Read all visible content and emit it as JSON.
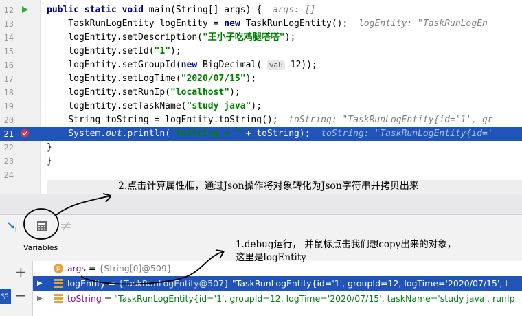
{
  "editor": {
    "lines": [
      {
        "num": "12",
        "segments": [
          [
            "kw",
            "public "
          ],
          [
            "kw",
            "static "
          ],
          [
            "kw",
            "void "
          ],
          [
            "",
            "main(String[] args) {  "
          ],
          [
            "hint",
            "args: []"
          ]
        ]
      },
      {
        "num": "13",
        "segments": [
          [
            "",
            "    TaskRunLogEntity logEntity = "
          ],
          [
            "kw",
            "new "
          ],
          [
            "",
            "TaskRunLogEntity();  "
          ],
          [
            "hint",
            "logEntity: \"TaskRunLogEn"
          ]
        ]
      },
      {
        "num": "14",
        "segments": [
          [
            "",
            "    logEntity.setDescription("
          ],
          [
            "str",
            "\"王小子吃鸡腿嗒嗒\""
          ],
          [
            "",
            ");"
          ]
        ]
      },
      {
        "num": "15",
        "segments": [
          [
            "",
            "    logEntity.setId("
          ],
          [
            "str",
            "\"1\""
          ],
          [
            "",
            ");"
          ]
        ]
      },
      {
        "num": "16",
        "segments": [
          [
            "",
            "    logEntity.setGroupId("
          ],
          [
            "kw",
            "new "
          ],
          [
            "",
            "BigDecimal( "
          ],
          [
            "tag",
            "val:"
          ],
          [
            "",
            " 12));"
          ]
        ]
      },
      {
        "num": "17",
        "segments": [
          [
            "",
            "    logEntity.setLogTime("
          ],
          [
            "str",
            "\"2020/07/15\""
          ],
          [
            "",
            ");"
          ]
        ]
      },
      {
        "num": "18",
        "segments": [
          [
            "",
            "    logEntity.setRunIp("
          ],
          [
            "str",
            "\"localhost\""
          ],
          [
            "",
            ");"
          ]
        ]
      },
      {
        "num": "19",
        "segments": [
          [
            "",
            "    logEntity.setTaskName("
          ],
          [
            "str",
            "\"study java\""
          ],
          [
            "",
            ");"
          ]
        ]
      },
      {
        "num": "20",
        "segments": [
          [
            "",
            "    String toString = logEntity.toString();  "
          ],
          [
            "hint",
            "toString: \"TaskRunLogEntity{id='1', gr"
          ]
        ]
      },
      {
        "num": "21",
        "segments": [
          [
            "",
            "    System."
          ],
          [
            "it",
            "out"
          ],
          [
            "",
            ".println("
          ],
          [
            "str",
            "\"toString = \""
          ],
          [
            "",
            " + toString);  "
          ],
          [
            "hint",
            "toString: \"TaskRunLogEntity{id='"
          ]
        ]
      },
      {
        "num": "22",
        "segments": [
          [
            "",
            "}"
          ]
        ]
      },
      {
        "num": "23",
        "segments": [
          [
            "",
            "}"
          ]
        ]
      },
      {
        "num": "24",
        "segments": []
      }
    ]
  },
  "annotations": {
    "step2": "2.点击计算属性框，通过Json操作将对象转化为Json字符串并拷贝出来",
    "step1_line1": "1.debug运行， 并鼠标点击我们想copy出来的对象，",
    "step1_line2": "这里是logEntity"
  },
  "debugger": {
    "variables_title": "Variables",
    "side_buttons": {
      "add": "+",
      "remove": "−"
    },
    "side_tab_text": "sp",
    "variables": [
      {
        "icon_letter": "p",
        "name": "args",
        "eq": " = ",
        "type": "{String[0]@509}",
        "value": ""
      },
      {
        "icon_letter": "f",
        "name": "logEntity",
        "eq": " = ",
        "type": "{TaskRunLogEntity@507}",
        "value": " \"TaskRunLogEntity{id='1', groupId=12, logTime='2020/07/15', t"
      },
      {
        "icon_letter": "f",
        "name": "toString",
        "eq": " = ",
        "type": "",
        "value": "\"TaskRunLogEntity{id='1', groupId=12, logTime='2020/07/15', taskName='study java', runIp"
      }
    ]
  },
  "colors": {
    "execution_line": "#2154b8",
    "keyword": "#000080",
    "string": "#008000",
    "breakpoint": "#d9334a",
    "run_arrow": "#3aa346"
  }
}
